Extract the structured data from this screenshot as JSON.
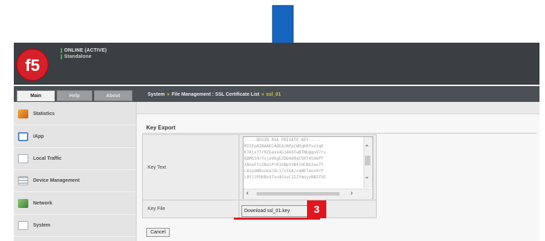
{
  "colors": {
    "accent_red": "#e0161e",
    "arrow_blue": "#1565c0",
    "header_bg": "#3b3f43",
    "status_green": "#2fbf3a",
    "breadcrumb_highlight": "#d8c640"
  },
  "header": {
    "status": "ONLINE (ACTIVE)",
    "mode": "Standalone",
    "logo_icon": "f5-logo-icon"
  },
  "tabs": [
    {
      "label": "Main"
    },
    {
      "label": "Help"
    },
    {
      "label": "About"
    }
  ],
  "breadcrumb": {
    "root": "System",
    "sep1": "»",
    "path": "File Management : SSL Certificate List",
    "sep2": "»",
    "current": "ssl_01"
  },
  "sidebar": {
    "items": [
      {
        "label": "Statistics",
        "icon": "statistics-icon",
        "color": "#d9822b"
      },
      {
        "label": "iApp",
        "icon": "iapp-icon",
        "color": "#5a86c5"
      },
      {
        "label": "Local Traffic",
        "icon": "local-traffic-icon",
        "color": "#9fa6ad"
      },
      {
        "label": "Device Management",
        "icon": "device-management-icon",
        "color": "#a8aeb3"
      },
      {
        "label": "Network",
        "icon": "network-icon",
        "color": "#6aa84f"
      },
      {
        "label": "System",
        "icon": "system-icon",
        "color": "#9fa6ad"
      }
    ]
  },
  "main": {
    "section_title": "Key Export",
    "key_text_label": "Key Text",
    "key_file_label": "Key File",
    "key_text_lines": [
      "-----BEGIN RSA PRIVATE KEY-----",
      "MIIEpAIBAAKCAQEAzNPpCWDqK0fvo1q0",
      "K7Ajx77r0ZGaxx4G1Ak6TwDTNkgqoV7rv",
      "QDMSS4/YxjaVKgE3DQ4b0qI9XT45dkPT",
      "X8oeFts2Ba1P+R1hBpoVB41HCNX2ax7Y",
      "LAzpdW8sobal8c17vShA/vqWE7eoo0rP",
      "L0YiiPUUBvX7xu4SzuC11JYmnyvBB2fXE"
    ],
    "download_label": "Download ssl_01.key",
    "cancel_label": "Cancel"
  },
  "annotation": {
    "step_number": "3"
  }
}
